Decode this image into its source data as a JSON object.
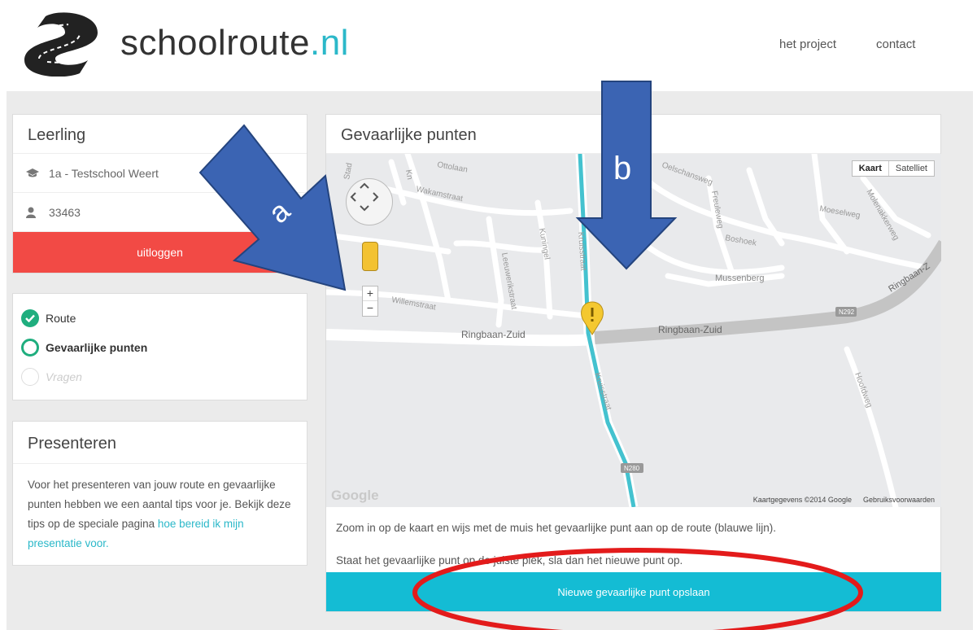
{
  "header": {
    "brand_name": "schoolroute",
    "brand_tld": ".nl",
    "nav": {
      "project": "het project",
      "contact": "contact"
    }
  },
  "leerling": {
    "title": "Leerling",
    "class_label": "1a - Testschool Weert",
    "student_id": "33463",
    "logout_label": "uitloggen"
  },
  "steps": [
    {
      "label": "Route",
      "state": "done"
    },
    {
      "label": "Gevaarlijke punten",
      "state": "current"
    },
    {
      "label": "Vragen",
      "state": "todo"
    }
  ],
  "present": {
    "title": "Presenteren",
    "text": "Voor het presenteren van jouw route en gevaarlijke punten hebben we een aantal tips voor je. Bekijk deze tips op de speciale pagina ",
    "link": "hoe bereid ik mijn presentatie voor."
  },
  "main": {
    "title": "Gevaarlijke punten",
    "map": {
      "type_map": "Kaart",
      "type_sat": "Satelliet",
      "zoom_in": "+",
      "zoom_out": "−",
      "attribution": "Kaartgegevens ©2014 Google",
      "terms": "Gebruiksvoorwaarden",
      "google": "Google",
      "streets": {
        "ringbaan_west": "Ringbaan-Zuid",
        "ringbaan_east": "Ringbaan-Zuid",
        "ringbaan_far": "Ringbaan-Z",
        "musschenberg": "Mussenberg",
        "willem": "Willemstraat",
        "wakam": "Wakamstraat",
        "ottolaan": "Ottolaan",
        "stadhouder": "Stad",
        "noord": "Kn",
        "leeuw": "Leeuwerikstraat",
        "kuningel": "Kuningel",
        "schans": "Oelschansweg",
        "freul": "Freuleweg",
        "boshoek": "Boshoek",
        "kruis": "Kruisstraat",
        "moesel": "Moeselweg",
        "hoofd": "Hoofdweg",
        "molen": "Molenakkerweg",
        "n292": "N292",
        "n280": "N280",
        "route_label": "Kruisstraat"
      }
    },
    "instruction_1": "Zoom in op de kaart en wijs met de muis het gevaarlijke punt aan op de route (blauwe lijn).",
    "instruction_2": "Staat het gevaarlijke punt op de juiste plek, sla dan het nieuwe punt op.",
    "save_label": "Nieuwe gevaarlijke punt opslaan"
  },
  "annotations": {
    "arrow_a": "a",
    "arrow_b": "b"
  },
  "colors": {
    "accent": "#2bb8c9",
    "danger": "#f24a45",
    "success": "#1fae7e",
    "save": "#14bcd4",
    "arrow": "#3b64b3",
    "highlight": "#e31b1b"
  }
}
